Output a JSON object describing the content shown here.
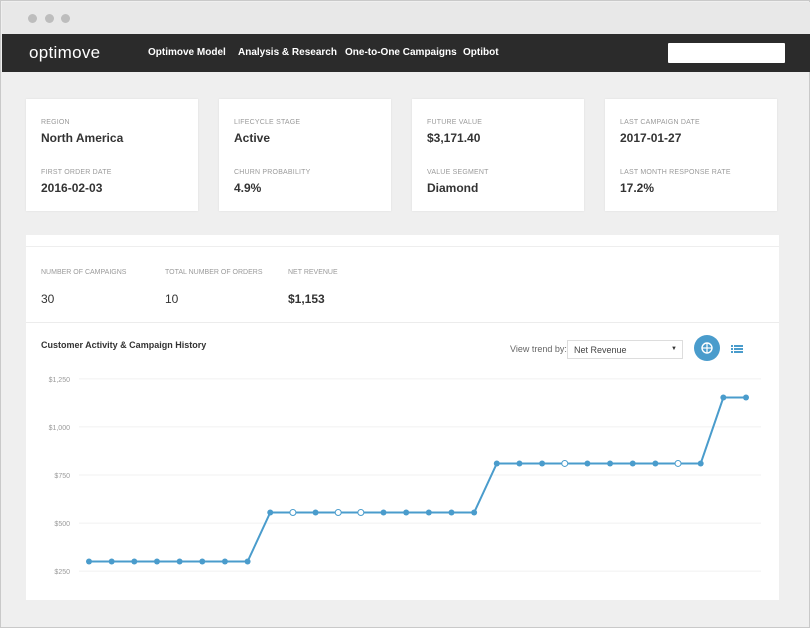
{
  "nav": {
    "logo": "optimove",
    "items": [
      "Optimove Model",
      "Analysis & Research",
      "One-to-One Campaigns",
      "Optibot"
    ],
    "search_value": ""
  },
  "cards": [
    {
      "label1": "REGION",
      "value1": "North America",
      "label2": "FIRST ORDER DATE",
      "value2": "2016-02-03"
    },
    {
      "label1": "LIFECYCLE STAGE",
      "value1": "Active",
      "label2": "CHURN PROBABILITY",
      "value2": "4.9%"
    },
    {
      "label1": "FUTURE VALUE",
      "value1": "$3,171.40",
      "label2": "VALUE SEGMENT",
      "value2": "Diamond"
    },
    {
      "label1": "LAST CAMPAIGN DATE",
      "value1": "2017-01-27",
      "label2": "LAST MONTH RESPONSE RATE",
      "value2": "17.2%"
    }
  ],
  "stats": [
    {
      "label": "NUMBER OF CAMPAIGNS",
      "value": "30"
    },
    {
      "label": "TOTAL NUMBER OF ORDERS",
      "value": "10"
    },
    {
      "label": "NET REVENUE",
      "value": "$1,153"
    }
  ],
  "chart_section": {
    "title": "Customer Activity & Campaign History",
    "trend_label": "View trend by:",
    "trend_value": "Net Revenue"
  },
  "colors": {
    "accent": "#4a9ccc",
    "navbar": "#2b2b2b"
  },
  "icons": {
    "chart_view": "chart-view-icon",
    "list_view": "list-view-icon",
    "dropdown": "caret-down-icon"
  },
  "chart_data": {
    "type": "line",
    "ytick_labels": [
      "$1,250",
      "$1,000",
      "$750",
      "$500",
      "$250"
    ],
    "yticks": [
      1250,
      1000,
      750,
      500,
      250
    ],
    "ylim": [
      230,
      1270
    ],
    "grid": true,
    "series": [
      {
        "values": [
          300,
          300,
          300,
          300,
          300,
          300,
          300,
          300,
          555,
          555,
          555,
          555,
          555,
          555,
          555,
          555,
          555,
          555,
          810,
          810,
          810,
          810,
          810,
          810,
          810,
          810,
          810,
          810,
          1153,
          1153
        ],
        "hollow": [
          9,
          11,
          12,
          21,
          26
        ]
      }
    ]
  }
}
